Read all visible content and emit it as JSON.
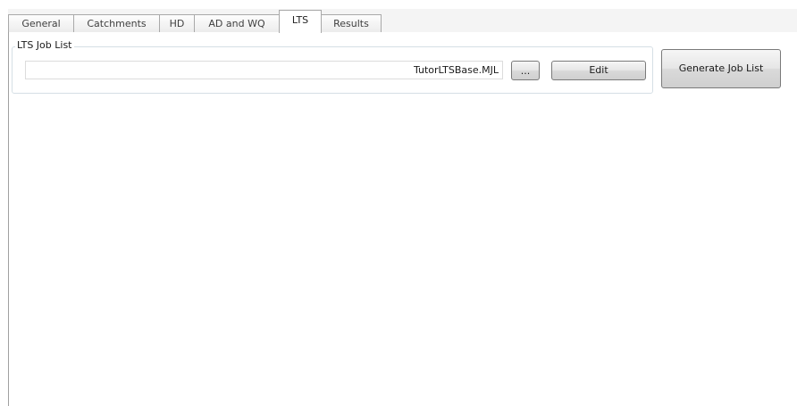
{
  "tabs": [
    {
      "label": "General",
      "active": false
    },
    {
      "label": "Catchments",
      "active": false
    },
    {
      "label": "HD",
      "active": false
    },
    {
      "label": "AD and WQ",
      "active": false
    },
    {
      "label": "LTS",
      "active": true
    },
    {
      "label": "Results",
      "active": false
    }
  ],
  "lts_job_list": {
    "group_title": "LTS Job List",
    "file_value": "TutorLTSBase.MJL",
    "browse_label": "...",
    "edit_label": "Edit"
  },
  "generate_job_list_label": "Generate Job List"
}
